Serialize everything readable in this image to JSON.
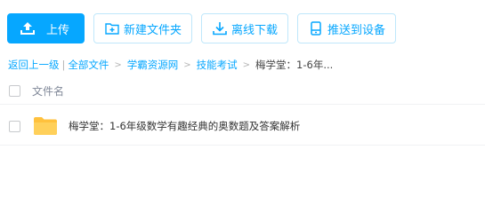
{
  "toolbar": {
    "upload_label": "上传",
    "new_folder_label": "新建文件夹",
    "offline_download_label": "离线下载",
    "push_to_device_label": "推送到设备",
    "accent_color": "#06a7ff"
  },
  "breadcrumb": {
    "back_label": "返回上一级",
    "separator": "|",
    "items": [
      "全部文件",
      "学霸资源网",
      "技能考试"
    ],
    "current": "梅学堂：1-6年..."
  },
  "file_list": {
    "column_name_header": "文件名",
    "rows": [
      {
        "name": "梅学堂：1-6年级数学有趣经典的奥数题及答案解析",
        "icon": "folder-icon"
      }
    ]
  }
}
